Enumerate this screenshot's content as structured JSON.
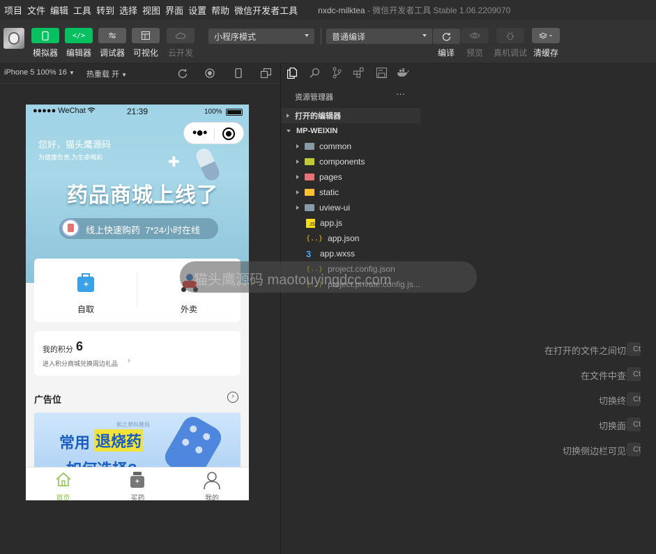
{
  "menu": [
    "项目",
    "文件",
    "编辑",
    "工具",
    "转到",
    "选择",
    "视图",
    "界面",
    "设置",
    "帮助",
    "微信开发者工具"
  ],
  "window_title": {
    "project": "nxdc-milktea",
    "sep": " - ",
    "app": "微信开发者工具 Stable 1.06.2209070"
  },
  "toolbar": {
    "buttons": [
      {
        "label": "模拟器",
        "icon": "phone-icon",
        "color": "#07c160"
      },
      {
        "label": "编辑器",
        "icon": "code-icon",
        "color": "#07c160"
      },
      {
        "label": "调试器",
        "icon": "sliders-icon",
        "color": "#555555"
      },
      {
        "label": "可视化",
        "icon": "layout-icon",
        "color": "#555555"
      },
      {
        "label": "云开发",
        "icon": "cloud-icon",
        "color": "#444444"
      }
    ],
    "mode_select": "小程序模式",
    "compile_select": "普通编译",
    "actions": [
      {
        "label": "编译",
        "icon": "refresh-icon"
      },
      {
        "label": "预览",
        "icon": "eye-icon"
      },
      {
        "label": "真机调试",
        "icon": "bug-icon"
      },
      {
        "label": "清缓存",
        "icon": "layers-icon"
      }
    ]
  },
  "subbar": {
    "device": "iPhone 5 100% 16",
    "hot_reload": "热重载 开"
  },
  "phone": {
    "status": {
      "carrier": "●●●●● WeChat",
      "time": "21:39",
      "battery": "100%"
    },
    "greeting": "您好，猫头鹰源码",
    "slogan": "为健康负责,为生命喝彩",
    "banner_title": "药品商城上线了",
    "banner_pill": "线上快速购药  7*24小时在线",
    "options": [
      {
        "label": "自取"
      },
      {
        "label": "外卖"
      }
    ],
    "points_label": "我的积分",
    "points_value": "6",
    "points_sub": "进入积分商城兑换周边礼品",
    "ad_title": "广告位",
    "ad_line1_a": "常用",
    "ad_line1_b": "退烧药",
    "ad_line2": "如何选择?",
    "ad_small": "和之草科普局",
    "tabs": [
      {
        "label": "首页"
      },
      {
        "label": "买药"
      },
      {
        "label": "我的"
      }
    ],
    "watermark": "猫头鹰源码 maotouyingdcc.com"
  },
  "explorer": {
    "title": "资源管理器",
    "more": "···",
    "open_editors": "打开的编辑器",
    "root": "MP-WEIXIN",
    "items": [
      {
        "name": "common",
        "kind": "folder",
        "color": "#8a9ba8"
      },
      {
        "name": "components",
        "kind": "folder",
        "color": "#c0ca33"
      },
      {
        "name": "pages",
        "kind": "folder",
        "color": "#e57373"
      },
      {
        "name": "static",
        "kind": "folder",
        "color": "#fbc02d"
      },
      {
        "name": "uview-ui",
        "kind": "folder",
        "color": "#8a9ba8"
      },
      {
        "name": "app.js",
        "kind": "js",
        "color": "#f5de19"
      },
      {
        "name": "app.json",
        "kind": "json",
        "color": "#f5c000"
      },
      {
        "name": "app.wxss",
        "kind": "css",
        "color": "#42a5f5"
      },
      {
        "name": "project.config.json",
        "kind": "json",
        "color": "#f5c000"
      },
      {
        "name": "project.private.config.js...",
        "kind": "json",
        "color": "#f5c000"
      }
    ]
  },
  "hints": [
    {
      "label": "在打开的文件之间切换",
      "key": "Ct"
    },
    {
      "label": "在文件中查找",
      "key": "Ct"
    },
    {
      "label": "切换终端",
      "key": "Ct"
    },
    {
      "label": "切换面板",
      "key": "Ct"
    },
    {
      "label": "切换侧边栏可见性",
      "key": "Ct"
    }
  ]
}
